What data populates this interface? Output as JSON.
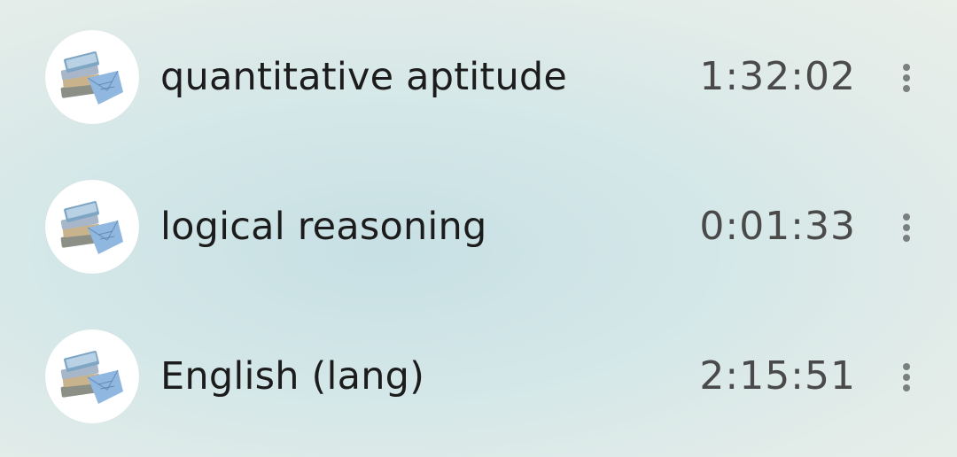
{
  "items": [
    {
      "title": "quantitative aptitude",
      "duration": "1:32:02",
      "icon": "books-icon",
      "menu_icon": "more-vert-icon"
    },
    {
      "title": "logical reasoning",
      "duration": "0:01:33",
      "icon": "books-icon",
      "menu_icon": "more-vert-icon"
    },
    {
      "title": "English (lang)",
      "duration": "2:15:51",
      "icon": "books-icon",
      "menu_icon": "more-vert-icon"
    }
  ],
  "colors": {
    "title": "#1c1c1c",
    "duration": "#4a4a4a",
    "menu_dots": "#7a7f80",
    "background": "#d4e7e8"
  }
}
